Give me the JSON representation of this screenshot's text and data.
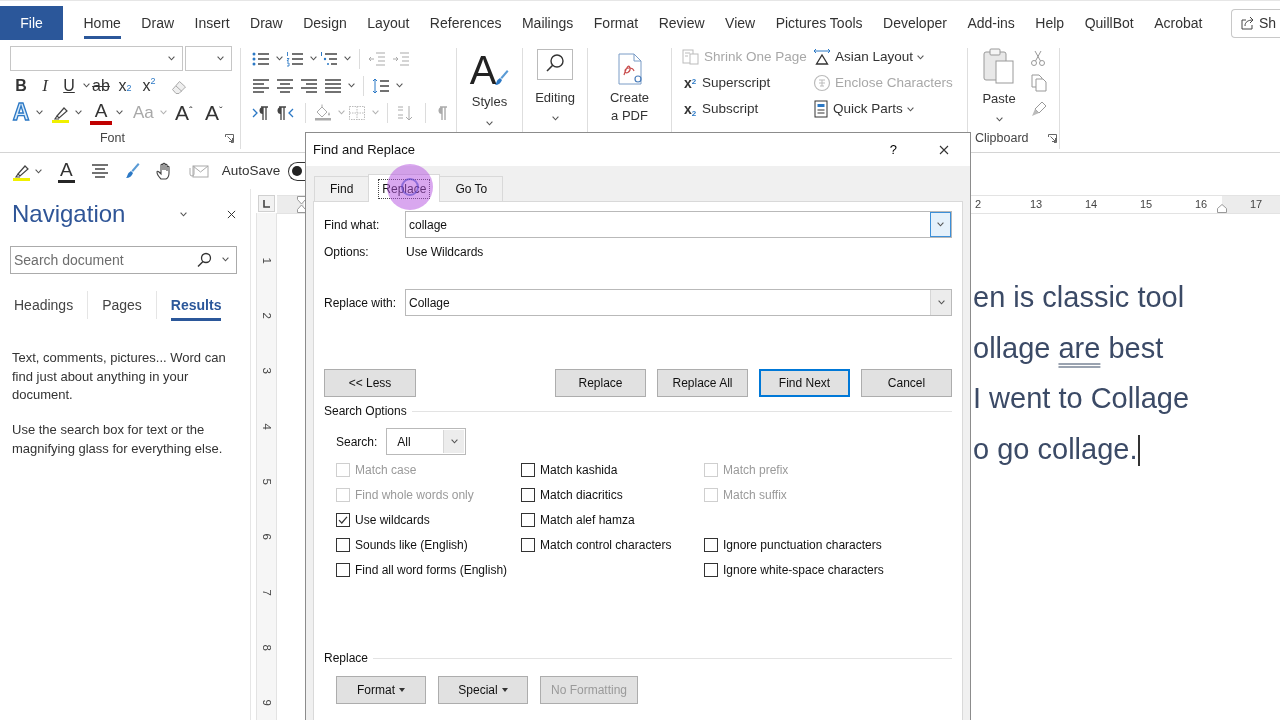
{
  "menu_tabs": [
    {
      "kind": "file",
      "label": "File",
      "selected": false
    },
    {
      "kind": "tab",
      "label": "Home",
      "selected": true
    },
    {
      "kind": "tab",
      "label": "Draw",
      "selected": false
    },
    {
      "kind": "tab",
      "label": "Insert",
      "selected": false
    },
    {
      "kind": "tab",
      "label": "Draw",
      "selected": false
    },
    {
      "kind": "tab",
      "label": "Design",
      "selected": false
    },
    {
      "kind": "tab",
      "label": "Layout",
      "selected": false
    },
    {
      "kind": "tab",
      "label": "References",
      "selected": false
    },
    {
      "kind": "tab",
      "label": "Mailings",
      "selected": false
    },
    {
      "kind": "tab",
      "label": "Format",
      "selected": false
    },
    {
      "kind": "tab",
      "label": "Review",
      "selected": false
    },
    {
      "kind": "tab",
      "label": "View",
      "selected": false
    },
    {
      "kind": "tab",
      "label": "Pictures Tools",
      "selected": false
    },
    {
      "kind": "tab",
      "label": "Developer",
      "selected": false
    },
    {
      "kind": "tab",
      "label": "Add-ins",
      "selected": false
    },
    {
      "kind": "tab",
      "label": "Help",
      "selected": false
    },
    {
      "kind": "tab",
      "label": "QuillBot",
      "selected": false
    },
    {
      "kind": "tab",
      "label": "Acrobat",
      "selected": false
    }
  ],
  "share_button": {
    "label": "Sh"
  },
  "ribbon": {
    "font": {
      "label": "Font",
      "format_buttons": [
        {
          "kind": "bold",
          "glyph": "B",
          "dropdown": false
        },
        {
          "kind": "italic",
          "glyph": "I",
          "dropdown": false
        },
        {
          "kind": "underline",
          "glyph": "U",
          "dropdown": true
        },
        {
          "kind": "strikethrough",
          "glyph": "ab",
          "dropdown": false
        },
        {
          "kind": "subscript",
          "glyph": "x$_{2}$",
          "dropdown": false
        },
        {
          "kind": "superscript",
          "glyph": "x$^{2}$",
          "dropdown": false
        }
      ],
      "effect_buttons": [
        {
          "kind": "text-effects",
          "glyph": "A",
          "dropdown": true,
          "disabled": false
        },
        {
          "kind": "highlight",
          "dropdown": true,
          "disabled": false
        },
        {
          "kind": "font-color",
          "glyph": "A",
          "dropdown": true,
          "disabled": false
        },
        {
          "kind": "change-case",
          "glyph": "Aa",
          "dropdown": true,
          "disabled": true
        },
        {
          "kind": "grow-font",
          "glyph": "A$^{ˆ}$",
          "dropdown": false,
          "disabled": false
        },
        {
          "kind": "shrink-font",
          "glyph": "A$^{ˇ}$",
          "dropdown": false,
          "disabled": false
        }
      ]
    },
    "styles": {
      "glyph": "A",
      "label": "Styles"
    },
    "editing": {
      "label": "Editing"
    },
    "pdf": {
      "label": "Create a PDF"
    },
    "asian_commands": [
      {
        "kind": "shrink",
        "label": "Shrink One Page",
        "disabled": true,
        "dropdown": false
      },
      {
        "kind": "superscript",
        "glyph": "x$^{2}$",
        "label": "Superscript",
        "disabled": false,
        "dropdown": false
      },
      {
        "kind": "subscript",
        "glyph": "x$_{2}$",
        "label": "Subscript",
        "disabled": false,
        "dropdown": false
      },
      {
        "kind": "asian-layout",
        "label": "Asian Layout",
        "disabled": false,
        "dropdown": true
      },
      {
        "kind": "enclose",
        "label": "Enclose Characters",
        "disabled": true,
        "dropdown": false
      },
      {
        "kind": "quick-parts",
        "label": "Quick Parts",
        "disabled": false,
        "dropdown": true
      }
    ],
    "clipboard": {
      "label": "Clipboard",
      "paste_label": "Paste"
    }
  },
  "quick_access": {
    "font_color_glyph": "A",
    "autosave": {
      "label": "AutoSave",
      "on": false
    }
  },
  "navigation": {
    "title": "Navigation",
    "search": {
      "placeholder": "Search document"
    },
    "tabs": [
      {
        "label": "Headings",
        "selected": false
      },
      {
        "label": "Pages",
        "selected": false
      },
      {
        "label": "Results",
        "selected": true
      }
    ],
    "paragraphs": [
      "Text, comments, pictures... Word can find just about anything in your document.",
      "Use the search box for text or the magnifying glass for everything else."
    ]
  },
  "rulers": {
    "horizontal": {
      "numbers": [
        "2",
        "13",
        "14",
        "15",
        "16",
        "17"
      ]
    },
    "vertical": {
      "numbers": [
        "1",
        "2",
        "3",
        "4",
        "5",
        "6",
        "7",
        "8",
        "9"
      ]
    }
  },
  "document": {
    "lines": [
      {
        "segments": [
          {
            "text": "en is classic tool",
            "flagged": false
          }
        ],
        "cursor": false
      },
      {
        "segments": [
          {
            "text": "ollage ",
            "flagged": false
          },
          {
            "text": "are",
            "flagged": true
          },
          {
            "text": " best",
            "flagged": false
          }
        ],
        "cursor": false
      },
      {
        "segments": [
          {
            "text": "I went to Collage",
            "flagged": false
          }
        ],
        "cursor": false
      },
      {
        "segments": [
          {
            "text": "o go collage.",
            "flagged": false
          }
        ],
        "cursor": true
      }
    ]
  },
  "dialog": {
    "title": "Find and Replace",
    "help": "?",
    "tabs": [
      {
        "label": "Find",
        "selected": false
      },
      {
        "label": "Replace",
        "selected": true
      },
      {
        "label": "Go To",
        "selected": false
      }
    ],
    "find_what": {
      "label": "Find what:",
      "value": "collage",
      "focused": true
    },
    "options": {
      "label": "Options:",
      "value": "Use Wildcards"
    },
    "replace_with": {
      "label": "Replace with:",
      "value": "Collage",
      "focused": false
    },
    "less_button": {
      "label": "<< Less"
    },
    "action_buttons": [
      {
        "label": "Replace",
        "default": false
      },
      {
        "label": "Replace All",
        "default": false
      },
      {
        "label": "Find Next",
        "default": true
      },
      {
        "label": "Cancel",
        "default": false
      }
    ],
    "search_options": {
      "title": "Search Options",
      "search": {
        "label": "Search:",
        "value": "All"
      },
      "columns": [
        {
          "groups": [
            {
              "items": [
                {
                  "label": "Match case",
                  "checked": false,
                  "disabled": true
                },
                {
                  "label": "Find whole words only",
                  "checked": false,
                  "disabled": true
                },
                {
                  "label": "Use wildcards",
                  "checked": true,
                  "disabled": false
                },
                {
                  "label": "Sounds like (English)",
                  "checked": false,
                  "disabled": false
                },
                {
                  "label": "Find all word forms (English)",
                  "checked": false,
                  "disabled": false
                }
              ]
            }
          ]
        },
        {
          "groups": [
            {
              "items": [
                {
                  "label": "Match kashida",
                  "checked": false,
                  "disabled": false
                },
                {
                  "label": "Match diacritics",
                  "checked": false,
                  "disabled": false
                },
                {
                  "label": "Match alef hamza",
                  "checked": false,
                  "disabled": false
                },
                {
                  "label": "Match control characters",
                  "checked": false,
                  "disabled": false
                }
              ]
            }
          ]
        },
        {
          "groups": [
            {
              "items": [
                {
                  "label": "Match prefix",
                  "checked": false,
                  "disabled": true
                },
                {
                  "label": "Match suffix",
                  "checked": false,
                  "disabled": true
                }
              ]
            },
            {
              "items": [
                {
                  "label": "Ignore punctuation characters",
                  "checked": false,
                  "disabled": false
                },
                {
                  "label": "Ignore white-space characters",
                  "checked": false,
                  "disabled": false
                }
              ]
            }
          ]
        }
      ]
    },
    "replace_section": {
      "title": "Replace",
      "buttons": [
        {
          "label": "Format",
          "dropdown": true,
          "disabled": false
        },
        {
          "label": "Special",
          "dropdown": true,
          "disabled": false
        },
        {
          "label": "No Formatting",
          "dropdown": false,
          "disabled": true
        }
      ]
    }
  }
}
